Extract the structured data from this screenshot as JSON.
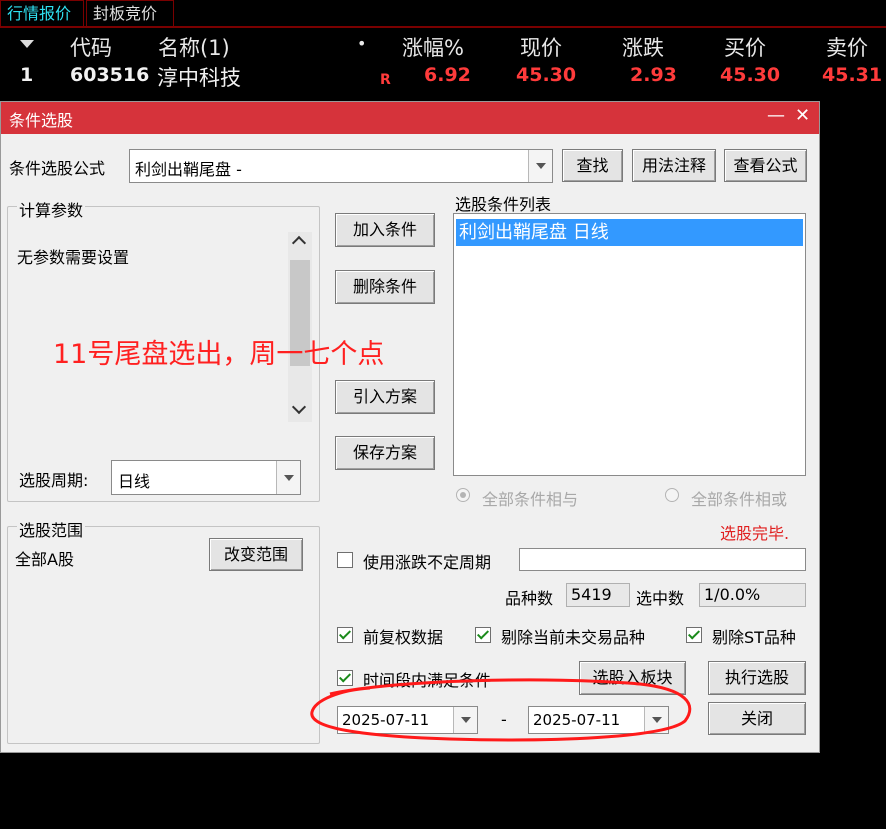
{
  "tabs": [
    "行情报价",
    "封板竞价"
  ],
  "quote": {
    "headers": {
      "code": "代码",
      "name": "名称(1)",
      "dot": "•",
      "change_pct": "涨幅%",
      "price": "现价",
      "change": "涨跌",
      "bid": "买价",
      "ask": "卖价"
    },
    "row": {
      "index": "1",
      "code": "603516",
      "name": "淳中科技",
      "flag": "R",
      "change_pct": "6.92",
      "price": "45.30",
      "change": "2.93",
      "bid": "45.30",
      "ask": "45.31"
    }
  },
  "dialog": {
    "title": "条件选股",
    "minimize": "—",
    "close": "✕",
    "formula_label": "条件选股公式",
    "formula_value": "利剑出鞘尾盘  -",
    "find_btn": "查找",
    "usage_btn": "用法注释",
    "view_btn": "查看公式",
    "params_group": "计算参数",
    "params_text": "无参数需要设置",
    "period_label": "选股周期:",
    "period_value": "日线",
    "range_group": "选股范围",
    "range_value": "全部A股",
    "change_range_btn": "改变范围",
    "add_btn": "加入条件",
    "delete_btn": "删除条件",
    "import_btn": "引入方案",
    "save_btn": "保存方案",
    "list_label": "选股条件列表",
    "list_items": [
      "利剑出鞘尾盘  日线"
    ],
    "radio_and": "全部条件相与",
    "radio_or": "全部条件相或",
    "status": "选股完毕.",
    "use_var_period": "使用涨跌不定周期",
    "count_label": "品种数",
    "count_value": "5419",
    "selected_label": "选中数",
    "selected_value": "1/0.0%",
    "cb_adjust": "前复权数据",
    "cb_exclude_untraded": "剔除当前未交易品种",
    "cb_exclude_st": "剔除ST品种",
    "cb_time_range": "时间段内满足条件",
    "to_block_btn": "选股入板块",
    "run_btn": "执行选股",
    "close_btn": "关闭",
    "date_from": "2025-07-11",
    "date_sep": "-",
    "date_to": "2025-07-11"
  },
  "annotation": "11号尾盘选出，周一七个点",
  "colors": {
    "accent_red": "#d6333b",
    "annotation": "#ff2020",
    "tab_active": "#2fe0f0",
    "list_select": "#3399ff"
  }
}
